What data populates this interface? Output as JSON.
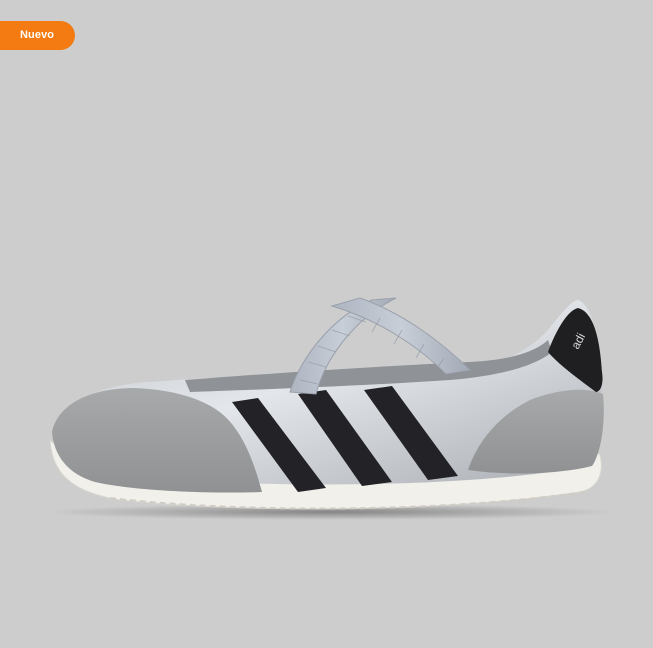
{
  "badge": {
    "label": "Nuevo",
    "color": "#f37b11"
  },
  "product_image": {
    "subject": "silver-and-black-flat-sneaker",
    "heel_logo_text": "adi",
    "background_color": "#cdcdcd"
  }
}
